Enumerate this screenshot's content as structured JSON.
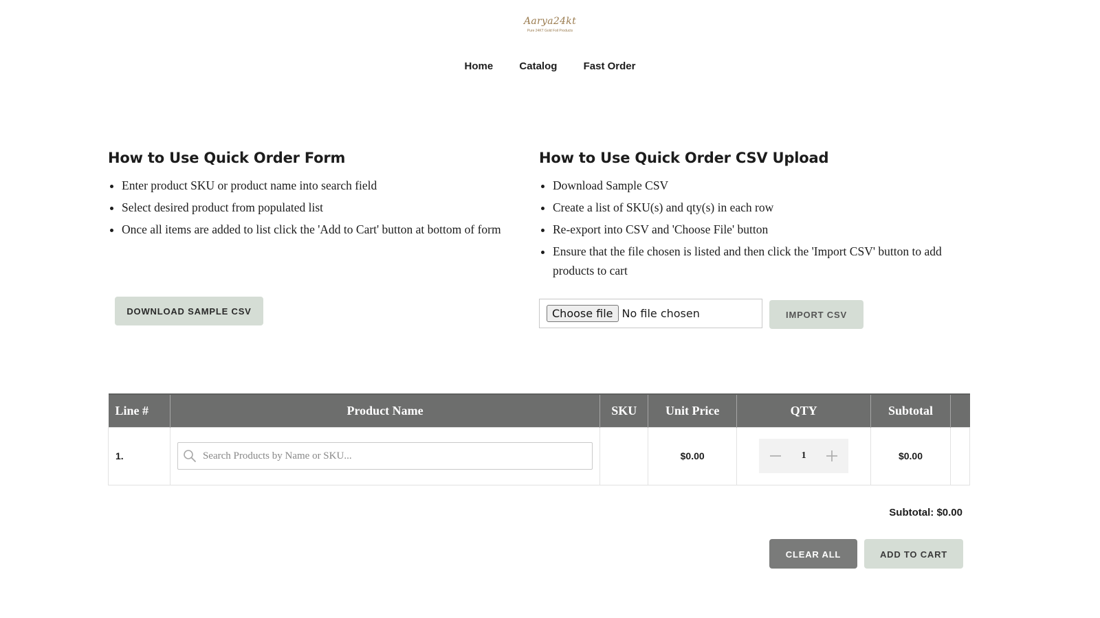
{
  "brand": {
    "logo_text": "Aarya24kt",
    "logo_tagline": "Pure 24KT Gold Foil Products"
  },
  "nav": {
    "items": [
      "Home",
      "Catalog",
      "Fast Order"
    ]
  },
  "form_help": {
    "title": "How to Use Quick Order Form",
    "steps": [
      "Enter product SKU or product name into search field",
      "Select desired product from populated list",
      "Once all items are added to list click the 'Add to Cart' button at bottom of form"
    ],
    "download_button": "DOWNLOAD SAMPLE CSV"
  },
  "csv_help": {
    "title": "How to Use Quick Order CSV Upload",
    "steps": [
      "Download Sample CSV",
      "Create a list of SKU(s) and qty(s) in each row",
      "Re-export into CSV and 'Choose File' button",
      "Ensure that the file chosen is listed and then click the 'Import CSV' button to add products to cart"
    ],
    "choose_file_label": "Choose file",
    "file_status": "No file chosen",
    "import_button": "IMPORT CSV"
  },
  "table": {
    "headers": [
      "Line #",
      "Product Name",
      "SKU",
      "Unit Price",
      "QTY",
      "Subtotal"
    ],
    "rows": [
      {
        "line": "1.",
        "search_placeholder": "Search Products by Name or SKU...",
        "sku": "",
        "unit_price": "$0.00",
        "qty": "1",
        "subtotal": "$0.00"
      }
    ]
  },
  "summary": {
    "subtotal_label": "Subtotal: $0.00"
  },
  "actions": {
    "clear_all": "CLEAR ALL",
    "add_to_cart": "ADD TO CART"
  },
  "colors": {
    "header_bg": "#6d6e6d",
    "sage_button": "#d5ddd5",
    "grey_button": "#7a7b7a",
    "logo_gold": "#9a7b4f"
  }
}
